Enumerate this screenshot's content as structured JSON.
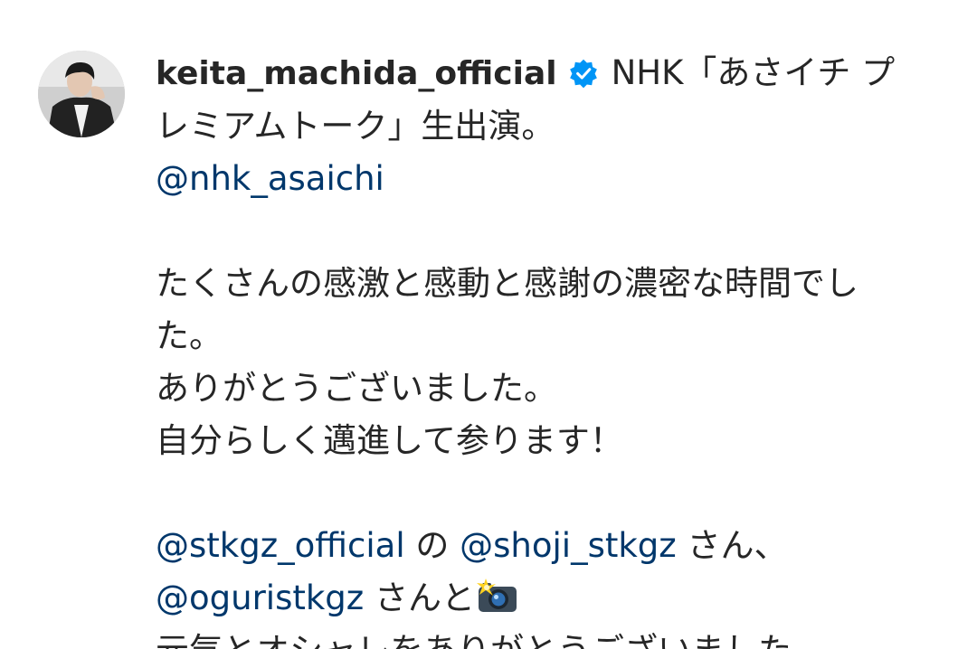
{
  "post": {
    "username": "keita_machida_official",
    "title_line1": "NHK「あさイチ プ",
    "title_line2": "レミアムトーク」生出演。",
    "mention_nhk": "@nhk_asaichi",
    "body_line1": "たくさんの感激と感動と感謝の濃密な時間でし",
    "body_line2": "た。",
    "body_line3": "ありがとうございました。",
    "body_line4": "自分らしく邁進して参ります！",
    "mention_stkgz": "@stkgz_official",
    "particle_no": "の",
    "mention_shoji": "@shoji_stkgz",
    "san_comma": "さん、",
    "mention_oguri": "@oguristkgz",
    "san_to": "さんと",
    "closing_line": "元気とオシャレをありがとうございました。"
  },
  "icons": {
    "verified": "verified-badge-icon",
    "camera": "camera-flash-emoji-icon"
  },
  "colors": {
    "text": "#262626",
    "mention": "#00376b",
    "verified_badge": "#0095f6"
  }
}
